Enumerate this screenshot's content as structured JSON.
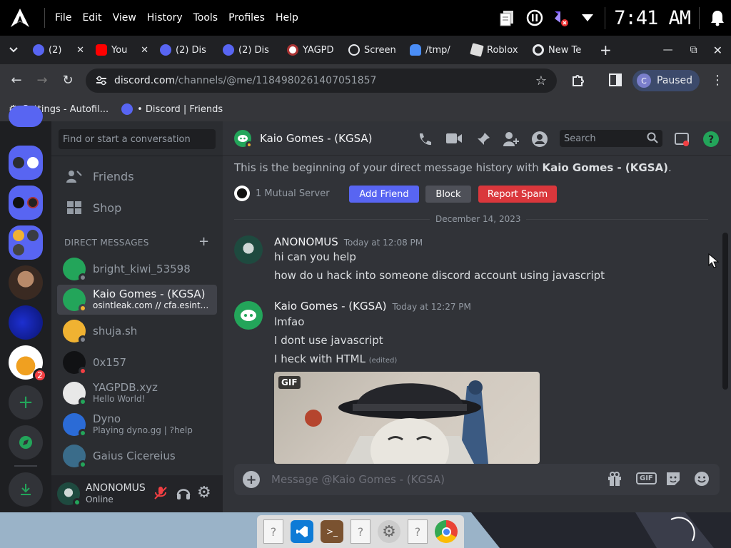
{
  "os": {
    "menu": [
      "File",
      "Edit",
      "View",
      "History",
      "Tools",
      "Profiles",
      "Help"
    ],
    "clock": "7:41 AM"
  },
  "tabs": [
    {
      "label": "(2)",
      "icon": "discord-icon"
    },
    {
      "label": "You",
      "icon": "youtube-icon"
    },
    {
      "label": "(2) Dis",
      "icon": "discord-icon"
    },
    {
      "label": "(2) Dis",
      "icon": "discord-icon"
    },
    {
      "label": "YAGPD",
      "icon": "yagpdb-icon"
    },
    {
      "label": "Screen",
      "icon": "globe-icon"
    },
    {
      "label": "/tmp/",
      "icon": "cloud-icon"
    },
    {
      "label": "Roblox",
      "icon": "roblox-icon"
    },
    {
      "label": "New Te",
      "icon": "chrome-icon"
    }
  ],
  "browser": {
    "url_host": "discord.com",
    "url_path": "/channels/@me/1184980261407051857",
    "profile_initial": "C",
    "profile_label": "Paused"
  },
  "bookmarks": [
    {
      "label": "Settings - Autofil...",
      "icon": "gear-icon"
    },
    {
      "label": "• Discord | Friends",
      "icon": "discord-icon"
    }
  ],
  "sidebar": {
    "search_placeholder": "Find or start a conversation",
    "friends_label": "Friends",
    "shop_label": "Shop",
    "dm_header": "DIRECT MESSAGES",
    "dms": [
      {
        "name": "bright_kiwi_53598",
        "sub": "",
        "status": "offline",
        "color": "#23a55a"
      },
      {
        "name": "Kaio Gomes - (KGSA)",
        "sub": "osintleak.com // cfa.esint...",
        "status": "idle",
        "color": "#23a55a"
      },
      {
        "name": "shuja.sh",
        "sub": "",
        "status": "offline",
        "color": "#f0b232"
      },
      {
        "name": "0x157",
        "sub": "",
        "status": "dnd",
        "color": "#111214"
      },
      {
        "name": "YAGPDB.xyz",
        "sub": "Hello World!",
        "status": "online",
        "color": "#e8e8e8"
      },
      {
        "name": "Dyno",
        "sub": "Playing dyno.gg | ?help",
        "status": "online",
        "color": "#2b6bd6"
      },
      {
        "name": "Gaius Cicereius",
        "sub": "",
        "status": "online",
        "color": "#3a6c8a"
      }
    ],
    "server_badge": "2",
    "user_name": "ANONOMUS",
    "user_status": "Online"
  },
  "chat": {
    "header_name": "Kaio Gomes - (KGSA)",
    "search_placeholder": "Search",
    "intro_prefix": "This is the beginning of your direct message history with ",
    "intro_name": "Kaio Gomes - (KGSA)",
    "intro_suffix": ".",
    "mutual": "1 Mutual Server",
    "add_friend": "Add Friend",
    "block": "Block",
    "report_spam": "Report Spam",
    "date_divider": "December 14, 2023",
    "messages": [
      {
        "author": "ANONOMUS",
        "time": "Today at 12:08 PM",
        "lines": [
          "hi can you help",
          "how do u hack into someone discord account using javascript"
        ]
      },
      {
        "author": "Kaio Gomes - (KGSA)",
        "time": "Today at 12:27 PM",
        "lines": [
          "lmfao",
          "I dont use javascript",
          "I heck with HTML"
        ],
        "edited": "(edited)"
      }
    ],
    "gif_label": "GIF",
    "composer_placeholder": "Message @Kaio Gomes - (KGSA)",
    "composer_gif": "GIF"
  },
  "colors": {
    "blurple": "#5865f2",
    "red": "#da373c",
    "green": "#23a55a",
    "idle": "#f0b232",
    "dnd": "#f23f43",
    "offline": "#80848e"
  }
}
